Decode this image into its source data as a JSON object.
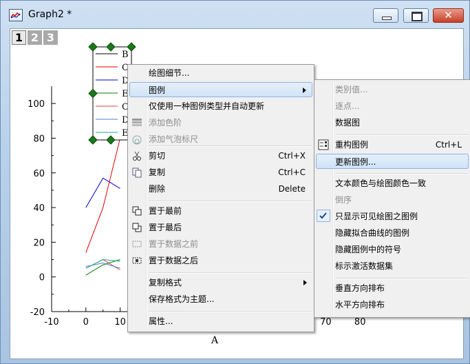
{
  "window": {
    "title": "Graph2 *",
    "close_glyph": "✕"
  },
  "layers": [
    "1",
    "2",
    "3"
  ],
  "chart_data": {
    "type": "line",
    "xlabel": "A",
    "ylabel": "",
    "xlim": [
      -10,
      90
    ],
    "ylim": [
      -20,
      110
    ],
    "x_ticks": [
      "-10",
      "0",
      "10",
      "70",
      "80"
    ],
    "y_ticks": [
      "100",
      "80",
      "60",
      "40",
      "20",
      "0",
      "-20"
    ],
    "legend_placement": "top-left",
    "series": [
      {
        "name": "B",
        "color": "#000000",
        "x": [],
        "y": []
      },
      {
        "name": "C",
        "color": "#dd0000",
        "x": [
          0,
          5,
          10
        ],
        "y": [
          14,
          40,
          80
        ]
      },
      {
        "name": "D",
        "color": "#0000cc",
        "x": [
          0,
          5,
          10
        ],
        "y": [
          40,
          57,
          51
        ]
      },
      {
        "name": "E",
        "color": "#007f00",
        "x": [
          0,
          5,
          10
        ],
        "y": [
          1,
          7,
          10
        ]
      },
      {
        "name": "C",
        "color": "#dd4444",
        "x": [
          0,
          5,
          10
        ],
        "y": [
          5,
          10,
          4
        ]
      },
      {
        "name": "D",
        "color": "#4a7fd0",
        "x": [
          0,
          5,
          10
        ],
        "y": [
          6,
          8,
          5
        ]
      },
      {
        "name": "E",
        "color": "#1aa89a",
        "x": [
          0,
          5,
          10
        ],
        "y": [
          5,
          10,
          9
        ]
      }
    ]
  },
  "context_menu": {
    "items": [
      {
        "label": "绘图细节...",
        "shortcut": "",
        "disabled": false
      },
      {
        "label": "图例",
        "shortcut": "",
        "disabled": false,
        "submenu": true,
        "highlighted": true
      },
      {
        "label": "仅使用一种图例类型并自动更新",
        "shortcut": "",
        "disabled": false
      },
      {
        "label": "添加色阶",
        "shortcut": "",
        "disabled": true,
        "icon": "colorscale-icon"
      },
      {
        "label": "添加气泡标尺",
        "shortcut": "",
        "disabled": true,
        "icon": "bubble-scale-icon"
      },
      {
        "label": "剪切",
        "shortcut": "Ctrl+X",
        "disabled": false,
        "icon": "scissors-icon"
      },
      {
        "label": "复制",
        "shortcut": "Ctrl+C",
        "disabled": false,
        "icon": "copy-icon"
      },
      {
        "label": "删除",
        "shortcut": "Delete",
        "disabled": false
      },
      {
        "label": "置于最前",
        "shortcut": "",
        "disabled": false,
        "icon": "bring-front-icon"
      },
      {
        "label": "置于最后",
        "shortcut": "",
        "disabled": false,
        "icon": "send-back-icon"
      },
      {
        "label": "置于数据之前",
        "shortcut": "",
        "disabled": true,
        "icon": "before-data-icon"
      },
      {
        "label": "置于数据之后",
        "shortcut": "",
        "disabled": false,
        "icon": "after-data-icon"
      },
      {
        "label": "复制格式",
        "shortcut": "",
        "disabled": false,
        "submenu": true
      },
      {
        "label": "保存格式为主题...",
        "shortcut": "",
        "disabled": false
      },
      {
        "label": "属性...",
        "shortcut": "",
        "disabled": false
      }
    ]
  },
  "legend_submenu": {
    "items": [
      {
        "label": "类别值...",
        "shortcut": "",
        "disabled": true
      },
      {
        "label": "逐点...",
        "shortcut": "",
        "disabled": true
      },
      {
        "label": "数据图",
        "shortcut": "",
        "disabled": false
      },
      {
        "label": "重构图例",
        "shortcut": "Ctrl+L",
        "disabled": false,
        "icon": "reconstruct-legend-icon"
      },
      {
        "label": "更新图例...",
        "shortcut": "",
        "disabled": false,
        "highlighted": true
      },
      {
        "label": "文本颜色与绘图颜色一致",
        "shortcut": "",
        "disabled": false
      },
      {
        "label": "倒序",
        "shortcut": "",
        "disabled": true
      },
      {
        "label": "只显示可见绘图之图例",
        "shortcut": "",
        "disabled": false,
        "checked": true
      },
      {
        "label": "隐藏拟合曲线的图例",
        "shortcut": "",
        "disabled": false
      },
      {
        "label": "隐藏图例中的符号",
        "shortcut": "",
        "disabled": false
      },
      {
        "label": "标示激活数据集",
        "shortcut": "",
        "disabled": false
      },
      {
        "label": "垂直方向排布",
        "shortcut": "",
        "disabled": false
      },
      {
        "label": "水平方向排布",
        "shortcut": "",
        "disabled": false
      }
    ]
  },
  "colors": {
    "menu_bg": "#f0f0f0",
    "highlight_border": "#8db2e3",
    "handle": "#1a7a1a"
  }
}
